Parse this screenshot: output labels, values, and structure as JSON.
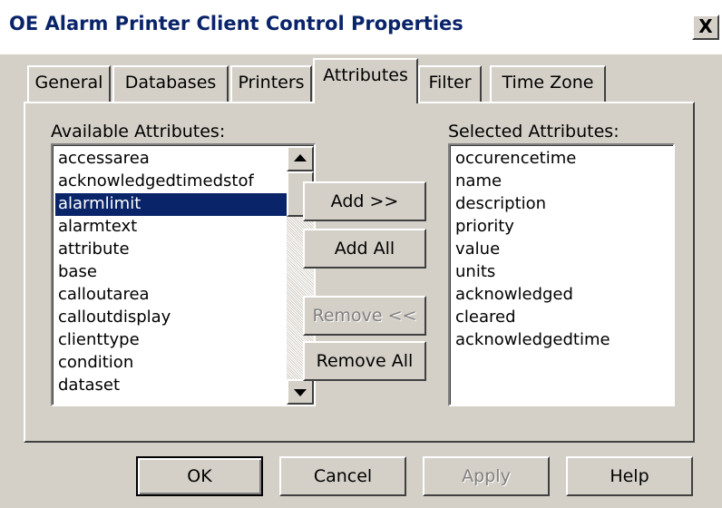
{
  "window": {
    "title": "OE Alarm Printer Client Control Properties",
    "close_glyph": "X"
  },
  "tabs": [
    {
      "label": "General",
      "active": false
    },
    {
      "label": "Databases",
      "active": false
    },
    {
      "label": "Printers",
      "active": false
    },
    {
      "label": "Attributes",
      "active": true
    },
    {
      "label": "Filter",
      "active": false
    },
    {
      "label": "Time Zone",
      "active": false
    }
  ],
  "available": {
    "label": "Available Attributes:",
    "items": [
      "accessarea",
      "acknowledgedtimedstof",
      "alarmlimit",
      "alarmtext",
      "attribute",
      "base",
      "calloutarea",
      "calloutdisplay",
      "clienttype",
      "condition",
      "dataset"
    ],
    "selected_index": 2
  },
  "selected": {
    "label": "Selected Attributes:",
    "items": [
      "occurencetime",
      "name",
      "description",
      "priority",
      "value",
      "units",
      "acknowledged",
      "cleared",
      "acknowledgedtime"
    ]
  },
  "middle_buttons": {
    "add": "Add >>",
    "add_all": "Add All",
    "remove": "Remove <<",
    "remove_all": "Remove All"
  },
  "footer_buttons": {
    "ok": "OK",
    "cancel": "Cancel",
    "apply": "Apply",
    "help": "Help"
  },
  "colors": {
    "face": "#d4d0c8",
    "selection": "#0a246a",
    "title_text": "#0a246a",
    "disabled_text": "#808080"
  }
}
